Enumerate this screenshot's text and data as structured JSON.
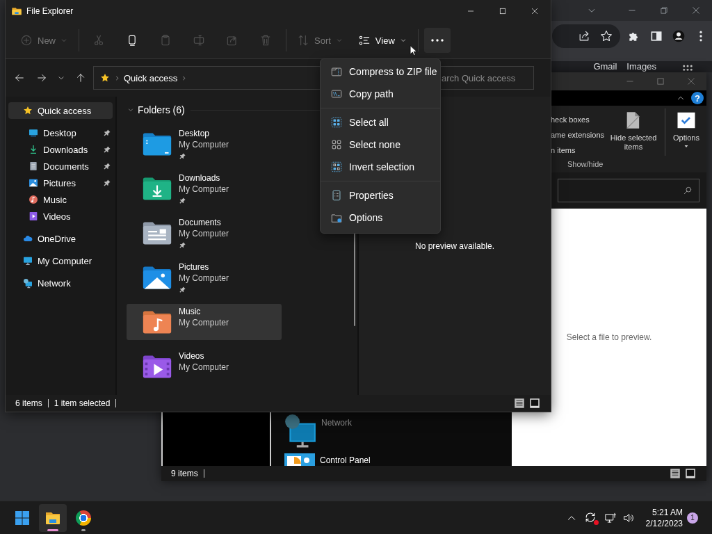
{
  "browser": {
    "links": [
      "Gmail",
      "Images"
    ]
  },
  "back_window": {
    "ribbon_options": [
      "heck boxes",
      "ame extensions",
      "n items"
    ],
    "hide_button": "Hide selected items",
    "options_button": "Options",
    "group_label": "Show/hide",
    "help": "?",
    "items": [
      {
        "name": "Network",
        "kind": "network",
        "dimmed": true
      },
      {
        "name": "Control Panel",
        "kind": "control-panel",
        "dimmed": false
      }
    ],
    "preview_text": "Select a file to preview.",
    "status": "9 items"
  },
  "explorer": {
    "title": "File Explorer",
    "toolbar": [
      {
        "kind": "new",
        "label": "New",
        "disabled": true,
        "pressed": false
      },
      {
        "kind": "cut",
        "disabled": true,
        "pressed": false
      },
      {
        "kind": "copy",
        "disabled": false,
        "pressed": false
      },
      {
        "kind": "paste",
        "disabled": true,
        "pressed": false
      },
      {
        "kind": "rename",
        "disabled": true,
        "pressed": false
      },
      {
        "kind": "share",
        "disabled": true,
        "pressed": false
      },
      {
        "kind": "delete",
        "disabled": true,
        "pressed": false
      },
      {
        "kind": "sort",
        "label": "Sort",
        "disabled": true,
        "pressed": false
      },
      {
        "kind": "view",
        "label": "View",
        "disabled": false,
        "pressed": false
      },
      {
        "kind": "more",
        "disabled": false,
        "pressed": true
      }
    ],
    "breadcrumb": [
      "Quick access"
    ],
    "search": {
      "placeholder": "arch Quick access"
    },
    "nav": [
      {
        "label": "Quick access",
        "kind": "star",
        "selected": true,
        "children": [
          {
            "label": "Desktop",
            "kind": "desktop",
            "pinned": true,
            "selected": false
          },
          {
            "label": "Downloads",
            "kind": "download",
            "pinned": true,
            "selected": false
          },
          {
            "label": "Documents",
            "kind": "document",
            "pinned": true,
            "selected": false
          },
          {
            "label": "Pictures",
            "kind": "picture",
            "pinned": true,
            "selected": false
          },
          {
            "label": "Music",
            "kind": "music",
            "pinned": false,
            "selected": false
          },
          {
            "label": "Videos",
            "kind": "video",
            "pinned": false,
            "selected": false
          }
        ]
      },
      {
        "label": "OneDrive",
        "kind": "cloud",
        "selected": false
      },
      {
        "label": "My Computer",
        "kind": "computer",
        "selected": false
      },
      {
        "label": "Network",
        "kind": "network",
        "selected": false
      }
    ],
    "group": {
      "title": "Folders (6)",
      "expanded": true
    },
    "tiles": [
      {
        "name": "Desktop",
        "location": "My Computer",
        "kind": "desktop",
        "pinned": true,
        "selected": false
      },
      {
        "name": "Downloads",
        "location": "My Computer",
        "kind": "downloads",
        "pinned": true,
        "selected": false
      },
      {
        "name": "Documents",
        "location": "My Computer",
        "kind": "documents",
        "pinned": true,
        "selected": false
      },
      {
        "name": "Pictures",
        "location": "My Computer",
        "kind": "pictures",
        "pinned": true,
        "selected": false
      },
      {
        "name": "Music",
        "location": "My Computer",
        "kind": "music",
        "pinned": false,
        "selected": true
      },
      {
        "name": "Videos",
        "location": "My Computer",
        "kind": "videos",
        "pinned": false,
        "selected": false
      }
    ],
    "preview_text": "No preview available.",
    "status": {
      "count": "6 items",
      "selection": "1 item selected"
    }
  },
  "menu": {
    "groups": [
      [
        {
          "kind": "zip",
          "label": "Compress to ZIP file"
        },
        {
          "kind": "copy-path",
          "label": "Copy path"
        }
      ],
      [
        {
          "kind": "select-all",
          "label": "Select all"
        },
        {
          "kind": "select-none",
          "label": "Select none"
        },
        {
          "kind": "invert",
          "label": "Invert selection"
        }
      ],
      [
        {
          "kind": "properties",
          "label": "Properties"
        },
        {
          "kind": "options",
          "label": "Options"
        }
      ]
    ]
  },
  "taskbar": {
    "apps": [
      {
        "kind": "start",
        "running": false,
        "active": false
      },
      {
        "kind": "explorer",
        "running": true,
        "active": true
      },
      {
        "kind": "chrome",
        "running": true,
        "active": false
      }
    ],
    "sync_alert": true,
    "time": "5:21 AM",
    "date": "2/12/2023",
    "notifications": "1"
  }
}
